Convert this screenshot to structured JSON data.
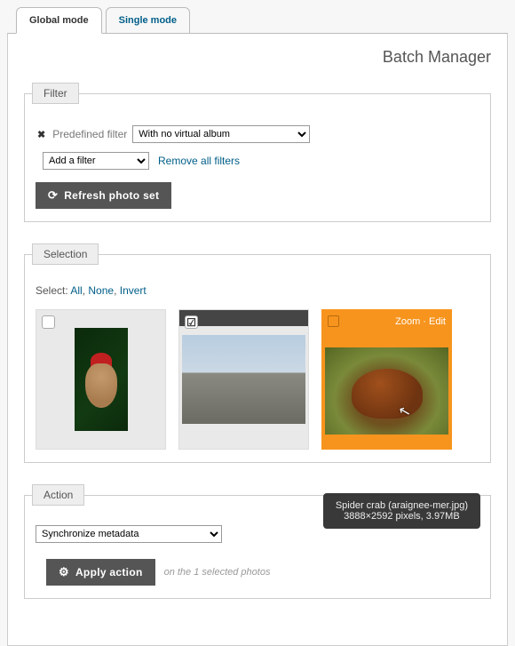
{
  "tabs": {
    "global": "Global mode",
    "single": "Single mode"
  },
  "page_title": "Batch Manager",
  "filter": {
    "legend": "Filter",
    "predefined_label": "Predefined filter",
    "predefined_value": "With no virtual album",
    "add_value": "Add a filter",
    "remove_all": "Remove all filters",
    "refresh": "Refresh photo set"
  },
  "selection": {
    "legend": "Selection",
    "select_label": "Select:",
    "all": "All",
    "none": "None",
    "invert": "Invert",
    "hover_zoom": "Zoom",
    "hover_sep": "·",
    "hover_edit": "Edit",
    "tooltip_line1": "Spider crab (araignee-mer.jpg)",
    "tooltip_line2": "3888×2592 pixels, 3.97MB"
  },
  "action": {
    "legend": "Action",
    "select_value": "Synchronize metadata",
    "apply": "Apply action",
    "note": "on the 1 selected photos"
  }
}
